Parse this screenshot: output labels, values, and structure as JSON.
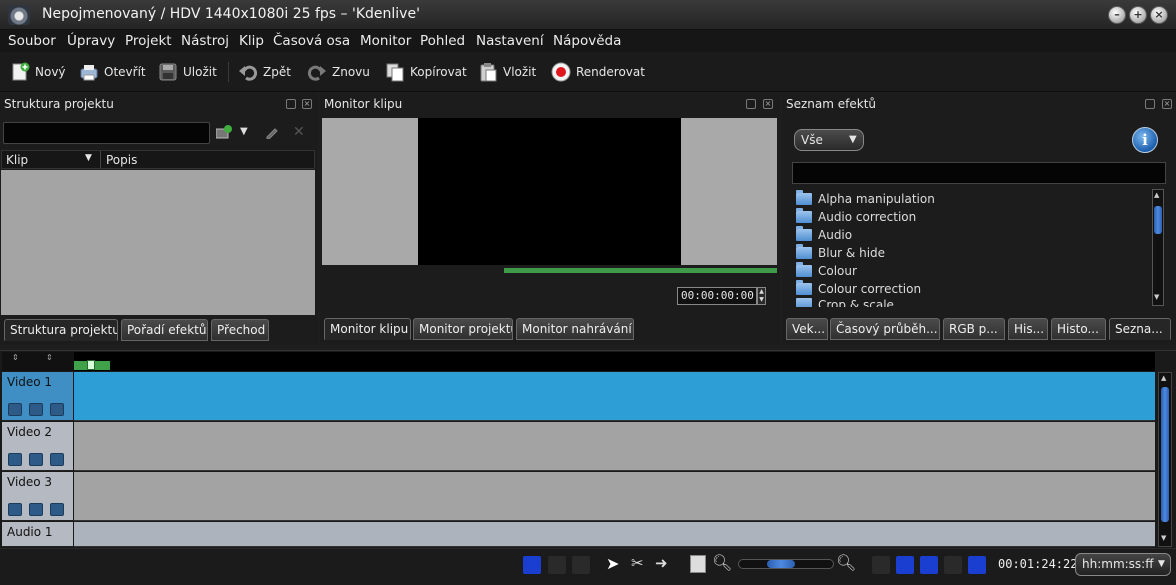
{
  "window": {
    "title": "Nepojmenovaný / HDV 1440x1080i 25 fps – 'Kdenlive'",
    "minimize_glyph": "–",
    "maximize_glyph": "+",
    "close_glyph": "×"
  },
  "menubar": {
    "items": [
      "Soubor",
      "Úpravy",
      "Projekt",
      "Nástroj",
      "Klip",
      "Časová osa",
      "Monitor",
      "Pohled",
      "Nastavení",
      "Nápověda"
    ]
  },
  "toolbar": {
    "new": "Nový",
    "open": "Otevřít",
    "save": "Uložit",
    "undo": "Zpět",
    "redo": "Znovu",
    "copy": "Kopírovat",
    "paste": "Vložit",
    "render": "Renderovat"
  },
  "project_panel": {
    "title": "Struktura projektu",
    "col_clip": "Klip",
    "col_desc": "Popis",
    "tabs": [
      "Struktura projektu",
      "Pořadí efektů",
      "Přechod"
    ]
  },
  "monitor_panel": {
    "title": "Monitor klipu",
    "timecode": "00:00:00:00",
    "tabs": [
      "Monitor klipu",
      "Monitor projektu",
      "Monitor nahrávání"
    ]
  },
  "effects_panel": {
    "title": "Seznam efektů",
    "filter_value": "Vše",
    "info_glyph": "i",
    "items": [
      "Alpha manipulation",
      "Audio correction",
      "Audio",
      "Blur & hide",
      "Colour",
      "Colour correction",
      "Crop & scale"
    ],
    "tabs": [
      "Vek...",
      "Časový průběh...",
      "RGB p...",
      "His...",
      "Histo...",
      "Sezna..."
    ]
  },
  "timeline": {
    "tracks": [
      "Video 1",
      "Video 2",
      "Video 3",
      "Audio 1"
    ],
    "colors": {
      "active_track": "#2e9fd6",
      "track": "#a3a3a3",
      "audio_track": "#adb3bd",
      "head_active": "#3f8fc4",
      "head": "#b5b9c1"
    }
  },
  "statusbar": {
    "timecode": "00:01:24:22",
    "format": "hh:mm:ss:ff"
  },
  "accent": "#2e9fd6"
}
